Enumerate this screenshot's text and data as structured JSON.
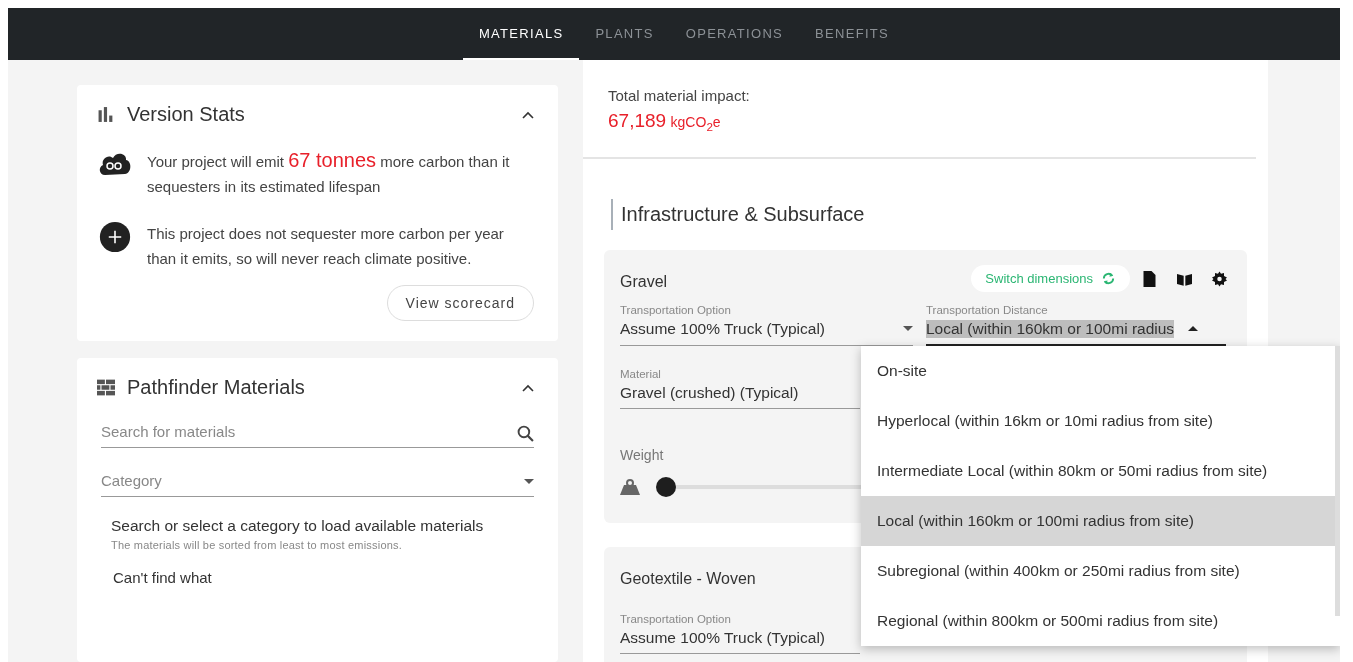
{
  "nav": {
    "tabs": [
      {
        "label": "MATERIALS",
        "selected": true
      },
      {
        "label": "PLANTS",
        "selected": false
      },
      {
        "label": "OPERATIONS",
        "selected": false
      },
      {
        "label": "BENEFITS",
        "selected": false
      }
    ]
  },
  "version_stats": {
    "title": "Version Stats",
    "expanded": true,
    "items": [
      {
        "kind": "co2",
        "text": "Your project will emit **67 tonnes** more carbon than it sequesters in its estimated lifespan"
      },
      {
        "kind": "plus",
        "text": "This project does not sequester more carbon per year than it emits, so will never reach climate positive."
      }
    ],
    "button": "View scorecard"
  },
  "pathfinder": {
    "title": "Pathfinder Materials",
    "expanded": true,
    "search": {
      "placeholder": "Search for materials"
    },
    "category": {
      "placeholder": "Category"
    },
    "hint": "Search or select a category to load available materials",
    "subhint": "The materials will be sorted from least to most emissions.",
    "cant_find": "Can't find what"
  },
  "impact": {
    "label": "Total material impact:",
    "value": "67,189",
    "unit": "kgCO$_{2}$e"
  },
  "section_title": "Infrastructure & Subsurface",
  "gravel": {
    "name": "Gravel",
    "switch_button": "Switch dimensions",
    "transport_option": {
      "label": "Transportation Option",
      "value": "Assume 100% Truck (Typical)"
    },
    "transport_distance": {
      "label": "Transportation Distance",
      "value": "Local (within 160km or 100mi radius",
      "expanded": true
    },
    "material": {
      "label": "Material",
      "value": "Gravel (crushed) (Typical)"
    },
    "weight": {
      "label": "Weight",
      "level": 0
    }
  },
  "geotextile": {
    "name": "Geotextile - Woven",
    "transport_option": {
      "label": "Transportation Option",
      "value": "Assume 100% Truck (Typical)"
    }
  },
  "distance_options": [
    {
      "label": "On-site",
      "selected": false
    },
    {
      "label": "Hyperlocal (within 16km or 10mi radius from site)",
      "selected": false
    },
    {
      "label": "Intermediate Local (within 80km or 50mi radius from site)",
      "selected": false
    },
    {
      "label": "Local (within 160km or 100mi radius from site)",
      "selected": true
    },
    {
      "label": "Subregional (within 400km or 250mi radius from site)",
      "selected": false
    },
    {
      "label": "Regional (within 800km or 500mi radius from site)",
      "selected": false
    }
  ]
}
